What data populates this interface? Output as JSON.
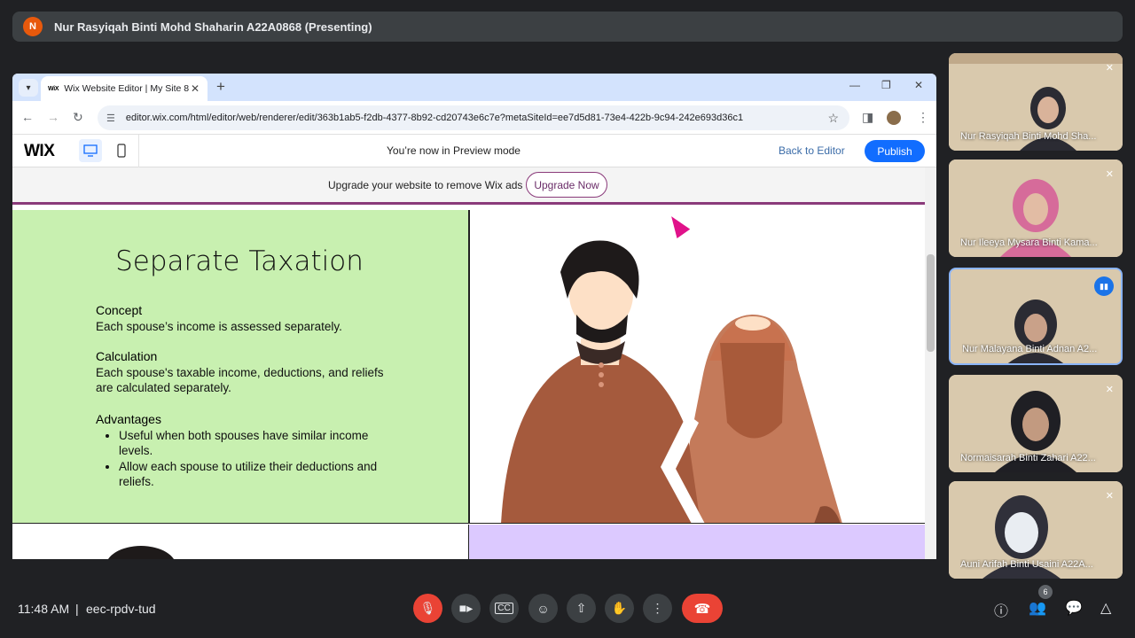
{
  "meet": {
    "presenter_initial": "N",
    "presenter_title": "Nur Rasyiqah Binti Mohd Shaharin A22A0868 (Presenting)",
    "time": "11:48 AM",
    "separator": "|",
    "meeting_code": "eec-rpdv-tud",
    "participant_count": "6",
    "participants": [
      {
        "name": "Nur Rasyiqah Binti Mohd Sha...",
        "muted": true
      },
      {
        "name": "Nur Ileeya Mysara Binti Kama...",
        "muted": true
      },
      {
        "name": "Nur Malayana Binti Adnan A2...",
        "muted": false,
        "speaking": true
      },
      {
        "name": "Normaisarah Binti Zahari A22...",
        "muted": true
      },
      {
        "name": "Auni Arifah Binti Usaini A22A...",
        "muted": true
      }
    ]
  },
  "browser": {
    "tab_favicon": "WiX",
    "tab_title": "Wix Website Editor | My Site 8",
    "url": "editor.wix.com/html/editor/web/renderer/edit/363b1ab5-f2db-4377-8b92-cd20743e6c7e?metaSiteId=ee7d5d81-73e4-422b-9c94-242e693d36c1"
  },
  "wix": {
    "logo": "WIX",
    "preview_message": "You’re now in Preview mode",
    "back_to_editor": "Back to Editor",
    "publish": "Publish",
    "ads_text": "Upgrade your website to remove Wix ads",
    "upgrade_now": "Upgrade Now"
  },
  "content": {
    "title": "Separate Taxation",
    "concept_heading": "Concept",
    "concept_text": "Each spouse’s income is assessed separately.",
    "calculation_heading": "Calculation",
    "calculation_text": "Each spouse's taxable income, deductions, and reliefs are calculated separately.",
    "advantages_heading": "Advantages",
    "advantages": [
      "Useful when both spouses have similar income levels.",
      "Allow each spouse to utilize their deductions and reliefs."
    ]
  },
  "colors": {
    "panel_green": "#c8f0b0",
    "panel_purple": "#dcc9ff",
    "publish_blue": "#116dff",
    "end_call_red": "#ea4335"
  }
}
